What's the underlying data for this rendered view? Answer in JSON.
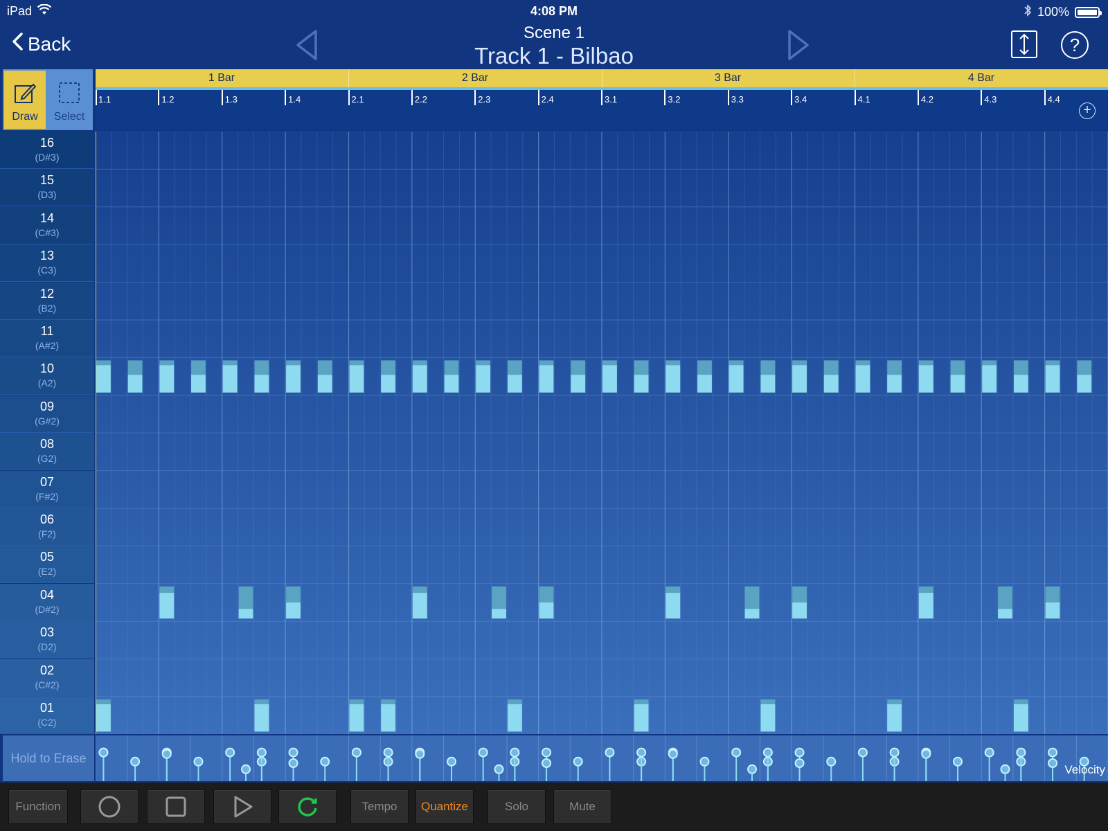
{
  "status_bar": {
    "device": "iPad",
    "time": "4:08 PM",
    "battery": "100%"
  },
  "nav": {
    "back_label": "Back",
    "scene_title": "Scene  1",
    "track_title": "Track 1 - Bilbao",
    "help_label": "?"
  },
  "tools": {
    "draw_label": "Draw",
    "select_label": "Select",
    "active": "Draw"
  },
  "ruler": {
    "bars": [
      "1 Bar",
      "2 Bar",
      "3 Bar",
      "4 Bar"
    ],
    "beats": [
      "1.1",
      "1.2",
      "1.3",
      "1.4",
      "2.1",
      "2.2",
      "2.3",
      "2.4",
      "3.1",
      "3.2",
      "3.3",
      "3.4",
      "4.1",
      "4.2",
      "4.3",
      "4.4"
    ]
  },
  "rows": [
    {
      "num": "16",
      "note": "(D#3)"
    },
    {
      "num": "15",
      "note": "(D3)"
    },
    {
      "num": "14",
      "note": "(C#3)"
    },
    {
      "num": "13",
      "note": "(C3)"
    },
    {
      "num": "12",
      "note": "(B2)"
    },
    {
      "num": "11",
      "note": "(A#2)"
    },
    {
      "num": "10",
      "note": "(A2)"
    },
    {
      "num": "09",
      "note": "(G#2)"
    },
    {
      "num": "08",
      "note": "(G2)"
    },
    {
      "num": "07",
      "note": "(F#2)"
    },
    {
      "num": "06",
      "note": "(F2)"
    },
    {
      "num": "05",
      "note": "(E2)"
    },
    {
      "num": "04",
      "note": "(D#2)"
    },
    {
      "num": "03",
      "note": "(D2)"
    },
    {
      "num": "02",
      "note": "(C#2)"
    },
    {
      "num": "01",
      "note": "(C2)"
    }
  ],
  "sequence": {
    "steps_per_bar": 16,
    "bars": 4,
    "notes": [
      {
        "row": "10",
        "steps": [
          0,
          2,
          4,
          6,
          8,
          10,
          12,
          14,
          16,
          18,
          20,
          22,
          24,
          26,
          28,
          30,
          32,
          34,
          36,
          38,
          40,
          42,
          44,
          46,
          48,
          50,
          52,
          54,
          56,
          58,
          60,
          62
        ],
        "velocities": [
          0.85,
          0.55,
          0.85,
          0.55,
          0.85,
          0.55,
          0.85,
          0.55,
          0.85,
          0.55,
          0.85,
          0.55,
          0.85,
          0.55,
          0.85,
          0.55,
          0.85,
          0.55,
          0.85,
          0.55,
          0.85,
          0.55,
          0.85,
          0.55,
          0.85,
          0.55,
          0.85,
          0.55,
          0.85,
          0.55,
          0.85,
          0.55
        ]
      },
      {
        "row": "04",
        "steps": [
          4,
          9,
          12,
          20,
          25,
          28,
          36,
          41,
          44,
          52,
          57,
          60
        ],
        "velocities": [
          0.8,
          0.3,
          0.5,
          0.8,
          0.3,
          0.5,
          0.8,
          0.3,
          0.5,
          0.8,
          0.3,
          0.5
        ]
      },
      {
        "row": "01",
        "steps": [
          0,
          10,
          16,
          18,
          26,
          34,
          42,
          50,
          58
        ],
        "velocities": [
          0.85,
          0.85,
          0.85,
          0.85,
          0.85,
          0.85,
          0.85,
          0.85,
          0.85
        ]
      }
    ]
  },
  "velocity": {
    "label": "Velocity",
    "erase_hint": "Hold to Erase"
  },
  "toolbar": {
    "function_label": "Function",
    "tempo_label": "Tempo",
    "quantize_label": "Quantize",
    "solo_label": "Solo",
    "mute_label": "Mute"
  },
  "colors": {
    "accent_yellow": "#e8ce4e",
    "note_fill": "#8edaf0",
    "quantize_orange": "#f08a24",
    "loop_green": "#23c44a"
  }
}
